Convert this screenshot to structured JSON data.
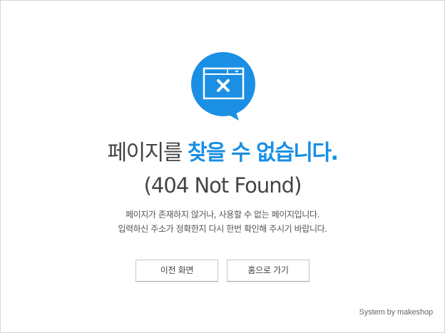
{
  "colors": {
    "accent": "#1a8fe3",
    "text": "#444444",
    "border": "#d5d5d5"
  },
  "icon": {
    "name": "browser-window-error-icon"
  },
  "headline": {
    "prefix": "페이지를 ",
    "accent": "찾을 수 없습니다."
  },
  "subhead": "(404 Not Found)",
  "description": {
    "line1": "페이지가 존재하지 않거나, 사용할 수 없는 페이지입니다.",
    "line2": "입력하신 주소가 정확한지 다시 한번 확인해 주시기 바랍니다."
  },
  "buttons": {
    "prev_label": "이전 화면",
    "home_label": "홈으로 가기"
  },
  "footer": "System by makeshop"
}
